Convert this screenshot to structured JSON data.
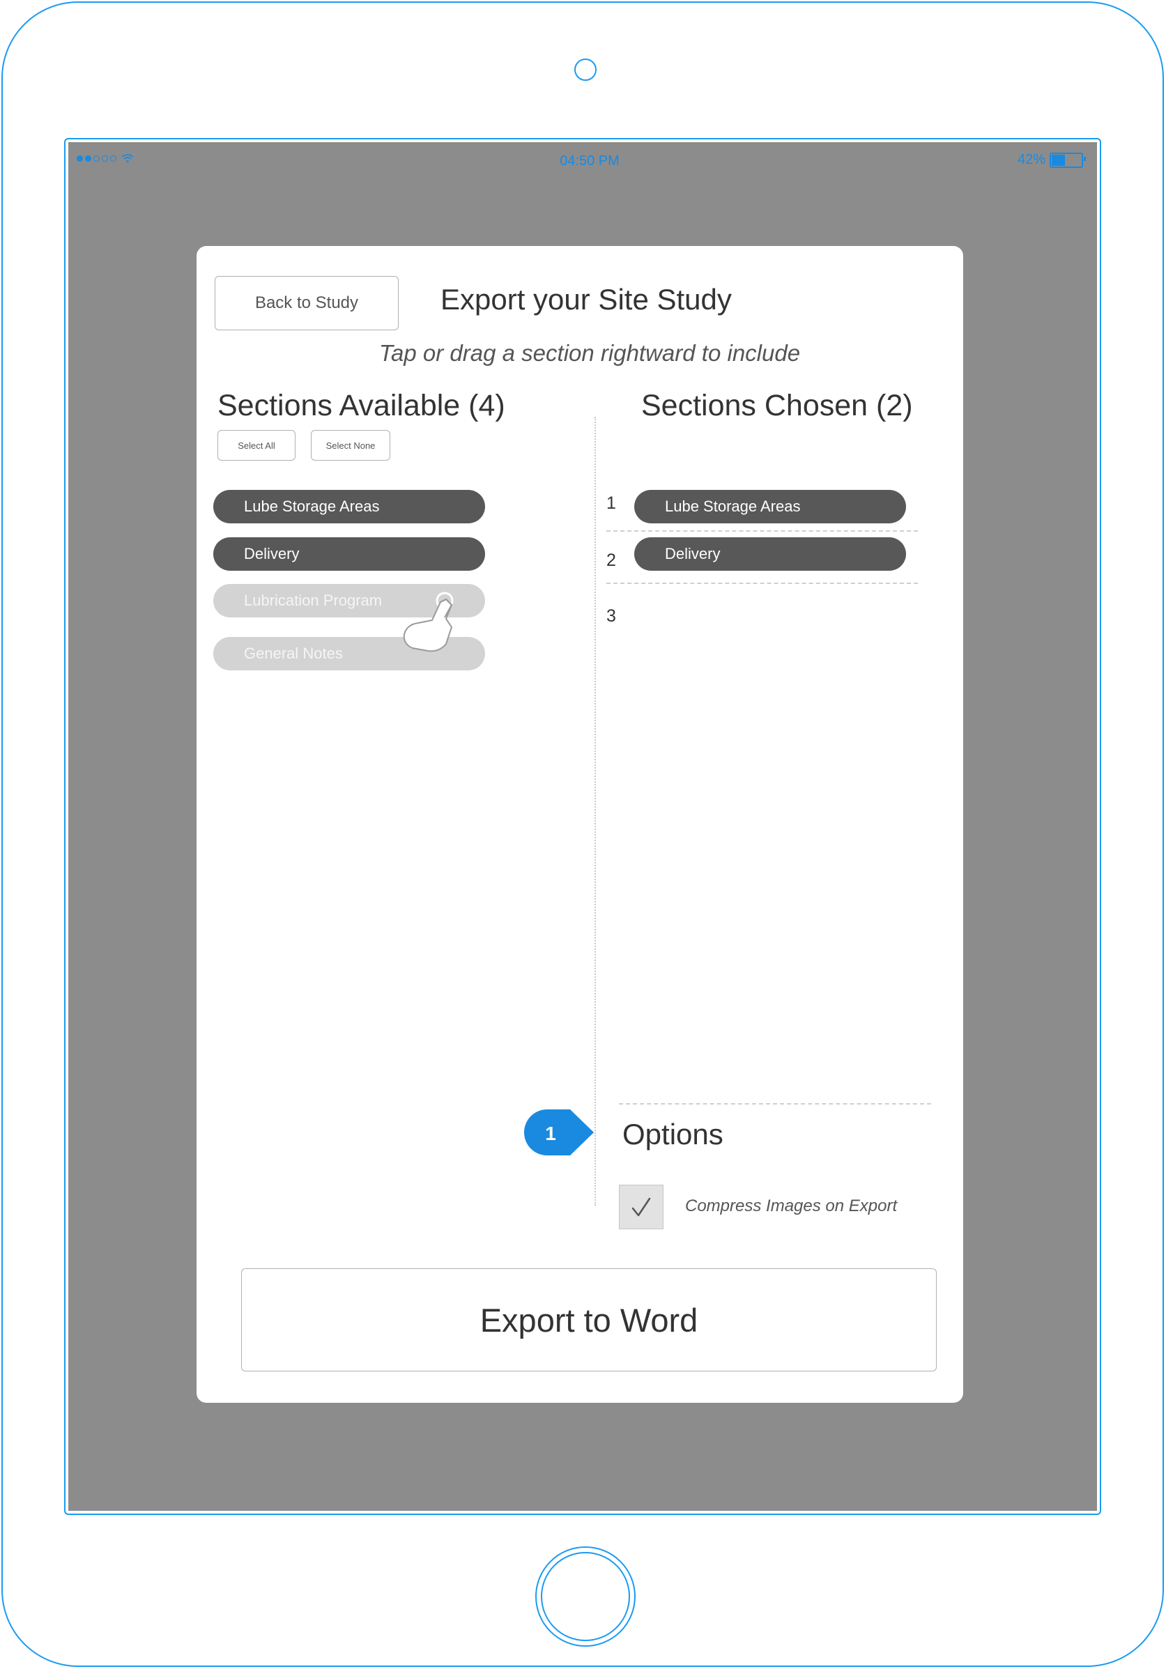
{
  "status_bar": {
    "signal_dots_filled": 2,
    "signal_dots_empty": 3,
    "wifi_icon": "wifi-icon",
    "time": "04:50 PM",
    "battery_percent": "42%",
    "battery_level": 0.42,
    "color": "#1a8ae0"
  },
  "header": {
    "back_button_label": "Back to Study",
    "title": "Export your Site Study",
    "subtitle": "Tap or drag a section rightward to include"
  },
  "available": {
    "heading": "Sections Available (4)",
    "select_all_label": "Select All",
    "select_none_label": "Select None",
    "items": [
      {
        "label": "Lube Storage Areas",
        "state": "selected"
      },
      {
        "label": "Delivery",
        "state": "selected"
      },
      {
        "label": "Lubrication Program",
        "state": "unselected"
      },
      {
        "label": "General Notes",
        "state": "unselected"
      }
    ]
  },
  "chosen": {
    "heading": "Sections Chosen (2)",
    "slots": [
      {
        "number": "1",
        "label": "Lube Storage Areas"
      },
      {
        "number": "2",
        "label": "Delivery"
      },
      {
        "number": "3",
        "label": ""
      }
    ]
  },
  "options": {
    "callout_number": "1",
    "heading": "Options",
    "compress_label": "Compress Images on Export",
    "compress_checked": true
  },
  "footer": {
    "export_button_label": "Export to Word"
  },
  "colors": {
    "frame": "#1a9bf0",
    "screen_bg": "#8c8c8c",
    "pill_dark": "#585858",
    "pill_light": "#d3d3d3",
    "callout": "#1a8ae0"
  }
}
